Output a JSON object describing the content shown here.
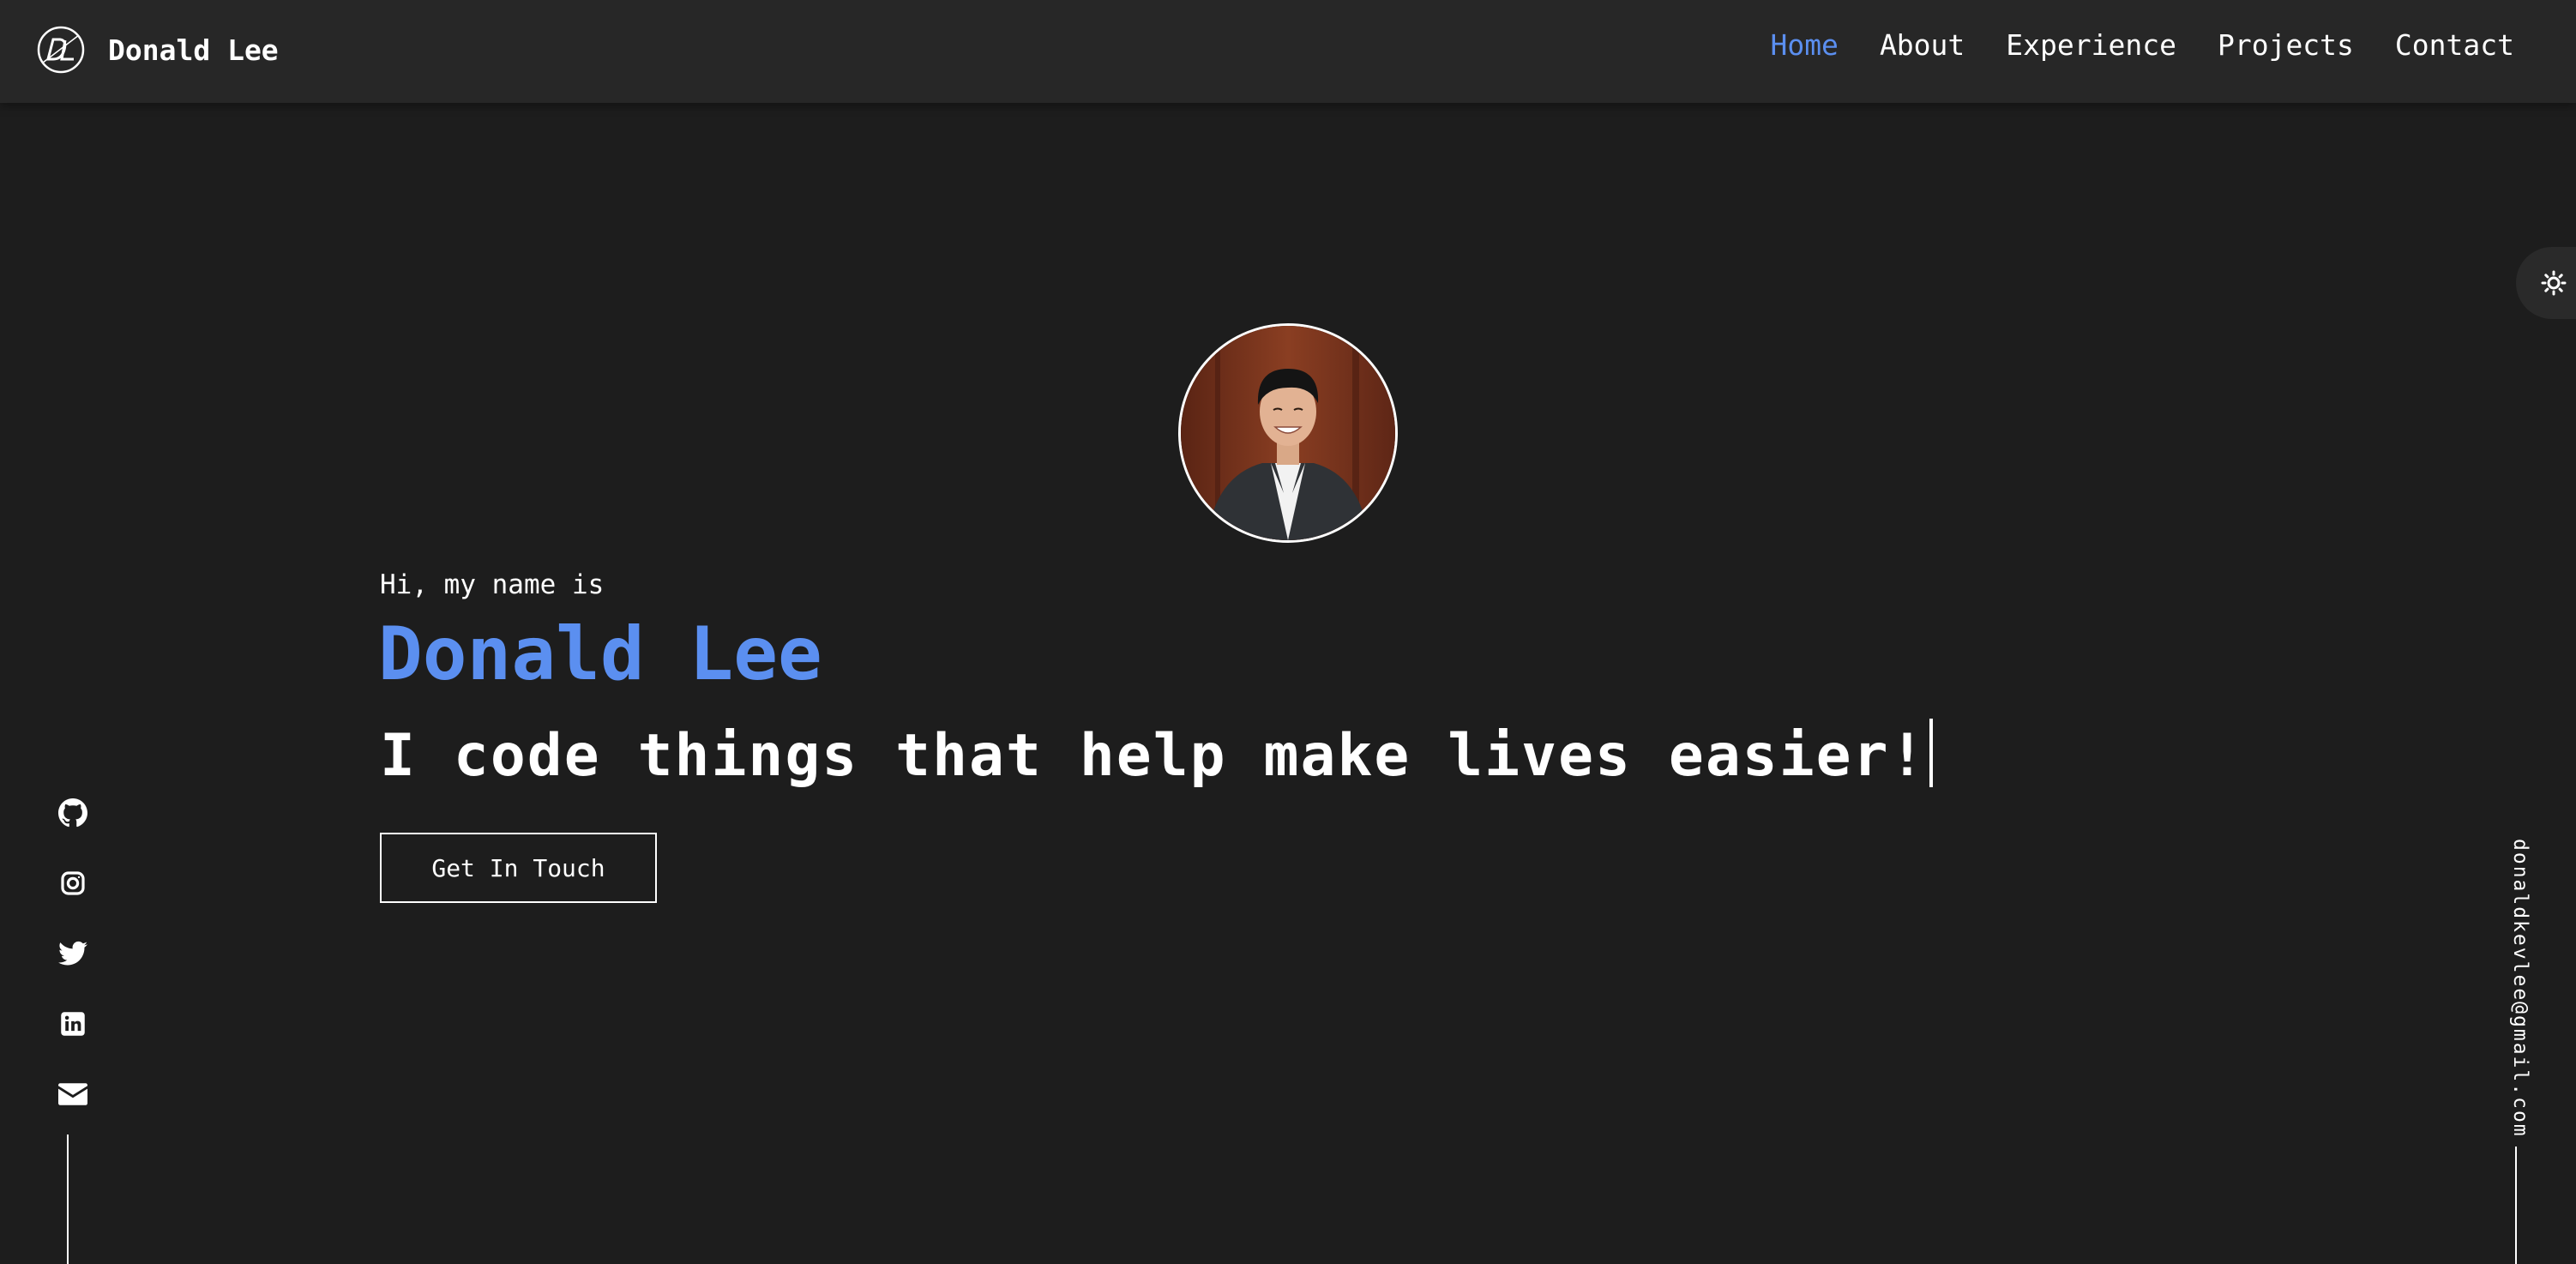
{
  "header": {
    "brand_name": "Donald Lee",
    "logo_icon": "dl-monogram-logo"
  },
  "nav": {
    "items": [
      {
        "label": "Home",
        "active": true
      },
      {
        "label": "About",
        "active": false
      },
      {
        "label": "Experience",
        "active": false
      },
      {
        "label": "Projects",
        "active": false
      },
      {
        "label": "Contact",
        "active": false
      }
    ]
  },
  "theme_toggle": {
    "icon": "sun-icon"
  },
  "hero": {
    "greeting": "Hi, my name is",
    "name": "Donald Lee",
    "tagline": "I code things that help make lives easier!",
    "cta_label": "Get In Touch",
    "avatar_alt": "profile-photo"
  },
  "social": {
    "icons": [
      "github-icon",
      "instagram-icon",
      "twitter-icon",
      "linkedin-icon",
      "mail-icon"
    ]
  },
  "email": {
    "address": "donaldkevlee@gmail.com"
  },
  "colors": {
    "background": "#1d1d1d",
    "navbar": "#272727",
    "accent": "#5b8ff0",
    "text": "#ffffff"
  }
}
